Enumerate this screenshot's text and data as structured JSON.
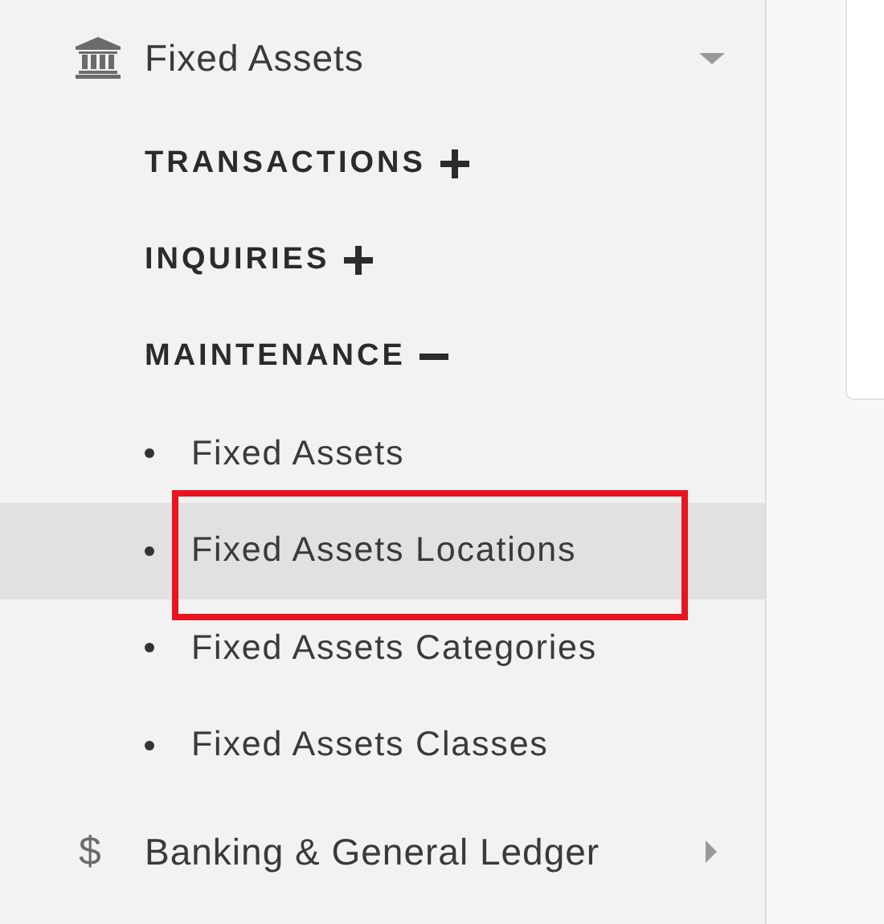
{
  "sidebar": {
    "modules": [
      {
        "label": "Fixed Assets",
        "icon": {
          "kind": "bank"
        },
        "expanded": true,
        "sections": [
          {
            "label": "TRANSACTIONS",
            "expanded": false
          },
          {
            "label": "INQUIRIES",
            "expanded": false
          },
          {
            "label": "MAINTENANCE",
            "expanded": true,
            "items": [
              {
                "label": "Fixed Assets",
                "selected": false,
                "annotated": false
              },
              {
                "label": "Fixed Assets Locations",
                "selected": true,
                "annotated": true
              },
              {
                "label": "Fixed Assets Categories",
                "selected": false,
                "annotated": false
              },
              {
                "label": "Fixed Assets Classes",
                "selected": false,
                "annotated": false
              }
            ]
          }
        ]
      },
      {
        "label": "Banking & General Ledger",
        "icon": {
          "kind": "glyph",
          "text": "$"
        },
        "expanded": false
      }
    ]
  }
}
